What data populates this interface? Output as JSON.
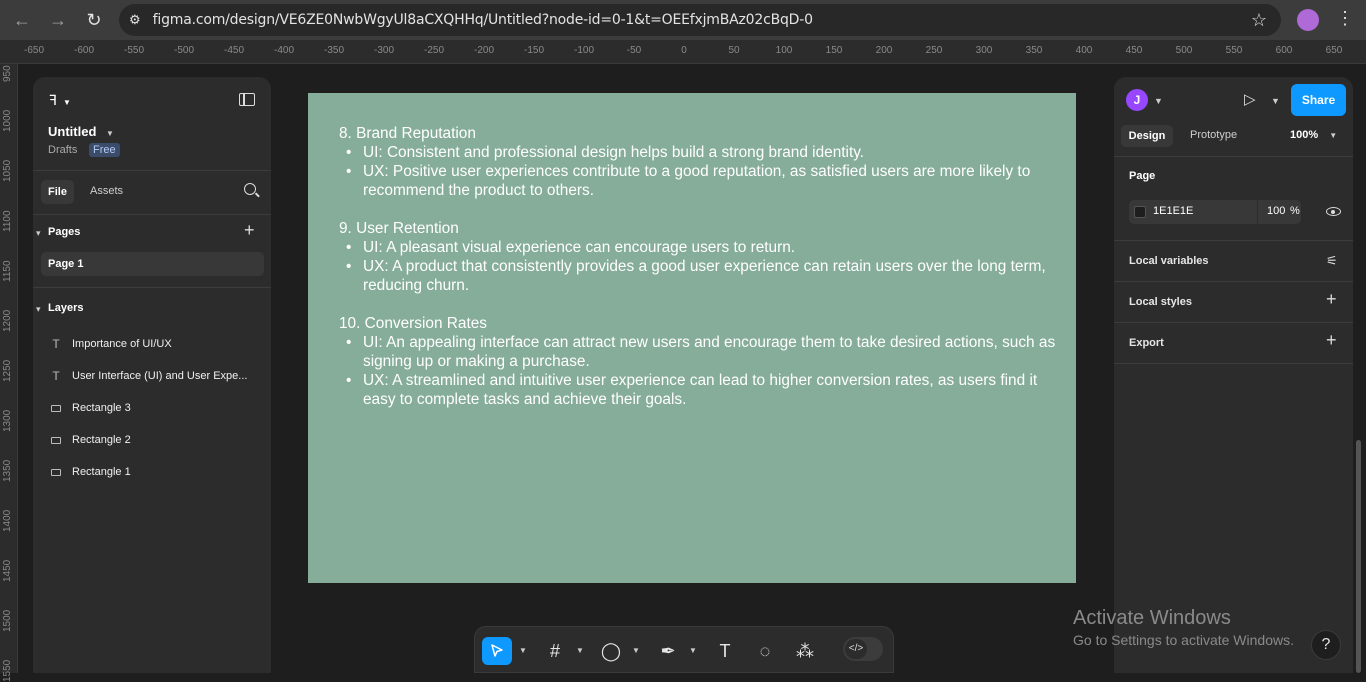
{
  "browser": {
    "url": "figma.com/design/VE6ZE0NwbWgyUl8aCXQHHq/Untitled?node-id=0-1&t=OEEfxjmBAz02cBqD-0"
  },
  "rulers": {
    "horizontal": [
      "-650",
      "-600",
      "-550",
      "-500",
      "-450",
      "-400",
      "-350",
      "-300",
      "-250",
      "-200",
      "-150",
      "-100",
      "-50",
      "0",
      "50",
      "100",
      "150",
      "200",
      "250",
      "300",
      "350",
      "400",
      "450",
      "500",
      "550",
      "600",
      "650"
    ],
    "vertical": [
      "950",
      "1000",
      "1050",
      "1100",
      "1150",
      "1200",
      "1250",
      "1300",
      "1350",
      "1400",
      "1450",
      "1500",
      "1550"
    ]
  },
  "left_panel": {
    "file_title": "Untitled",
    "location": "Drafts",
    "plan_badge": "Free",
    "tabs": {
      "file": "File",
      "assets": "Assets"
    },
    "pages_header": "Pages",
    "pages": [
      "Page 1"
    ],
    "layers_header": "Layers",
    "layers": [
      {
        "type": "text",
        "name": "Importance of UI/UX"
      },
      {
        "type": "text",
        "name": "User Interface (UI) and User Expe..."
      },
      {
        "type": "rect",
        "name": "Rectangle 3"
      },
      {
        "type": "rect",
        "name": "Rectangle 2"
      },
      {
        "type": "rect",
        "name": "Rectangle 1"
      }
    ]
  },
  "frame": {
    "background": "#86ad99",
    "sections": [
      {
        "heading": "8. Brand Reputation",
        "bullets": [
          "UI: Consistent and professional design helps build a strong brand identity.",
          "UX: Positive user experiences contribute to a good reputation, as satisfied users are more likely to recommend the product to others."
        ]
      },
      {
        "heading": "9. User Retention",
        "bullets": [
          "UI: A pleasant visual experience can encourage users to return.",
          "UX: A product that consistently provides a good user experience can retain users over the long term, reducing churn."
        ]
      },
      {
        "heading": "10. Conversion Rates",
        "bullets": [
          "UI: An appealing interface can attract new users and encourage them to take desired actions, such as signing up or making a purchase.",
          "UX: A streamlined and intuitive user experience can lead to higher conversion rates, as users find it easy to complete tasks and achieve their goals."
        ]
      }
    ]
  },
  "right_panel": {
    "avatar_initial": "J",
    "share_label": "Share",
    "tabs": {
      "design": "Design",
      "prototype": "Prototype"
    },
    "zoom": "100%",
    "page_label": "Page",
    "page_color_hex": "1E1E1E",
    "page_opacity": "100",
    "opacity_unit": "%",
    "local_variables": "Local variables",
    "local_styles": "Local styles",
    "export": "Export"
  },
  "watermark": {
    "line1": "Activate Windows",
    "line2": "Go to Settings to activate Windows."
  },
  "help_label": "?",
  "colors": {
    "accent": "#0d99ff",
    "frame": "#86ad99",
    "panel": "#2c2c2c",
    "canvas": "#1e1e1e"
  }
}
